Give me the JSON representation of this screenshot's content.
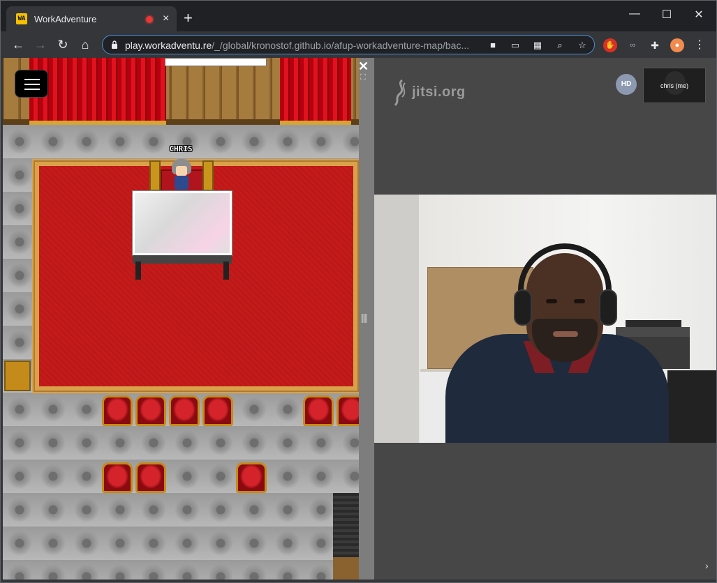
{
  "browser": {
    "tab": {
      "title": "WorkAdventure",
      "favicon_text": "WA"
    },
    "url_host": "play.workadventu.re",
    "url_rest": "/_/global/kronostof.github.io/afup-workadventure-map/bac...",
    "window_controls": {
      "minimize": "—",
      "maximize": "☐",
      "close": "✕"
    }
  },
  "game": {
    "player_name": "CHRIS"
  },
  "jitsi": {
    "logo_text": "jitsi.org",
    "hd_badge": "HD",
    "thumbnail_label": "chris (me)"
  },
  "colors": {
    "chrome_dark": "#202124",
    "chrome_toolbar": "#35363a",
    "jitsi_bg": "#474747",
    "carpet_red": "#c41a1a",
    "gold_trim": "#d9a24a",
    "recording_dot": "#e53935"
  },
  "icons": [
    "back-icon",
    "forward-icon",
    "reload-icon",
    "home-icon",
    "lock-icon",
    "camera-icon",
    "cast-icon",
    "apps-icon",
    "zoom-icon",
    "star-icon",
    "extensions-icon",
    "menu-icon",
    "close-icon",
    "fullscreen-icon",
    "chevron-right-icon",
    "hamburger-icon"
  ]
}
